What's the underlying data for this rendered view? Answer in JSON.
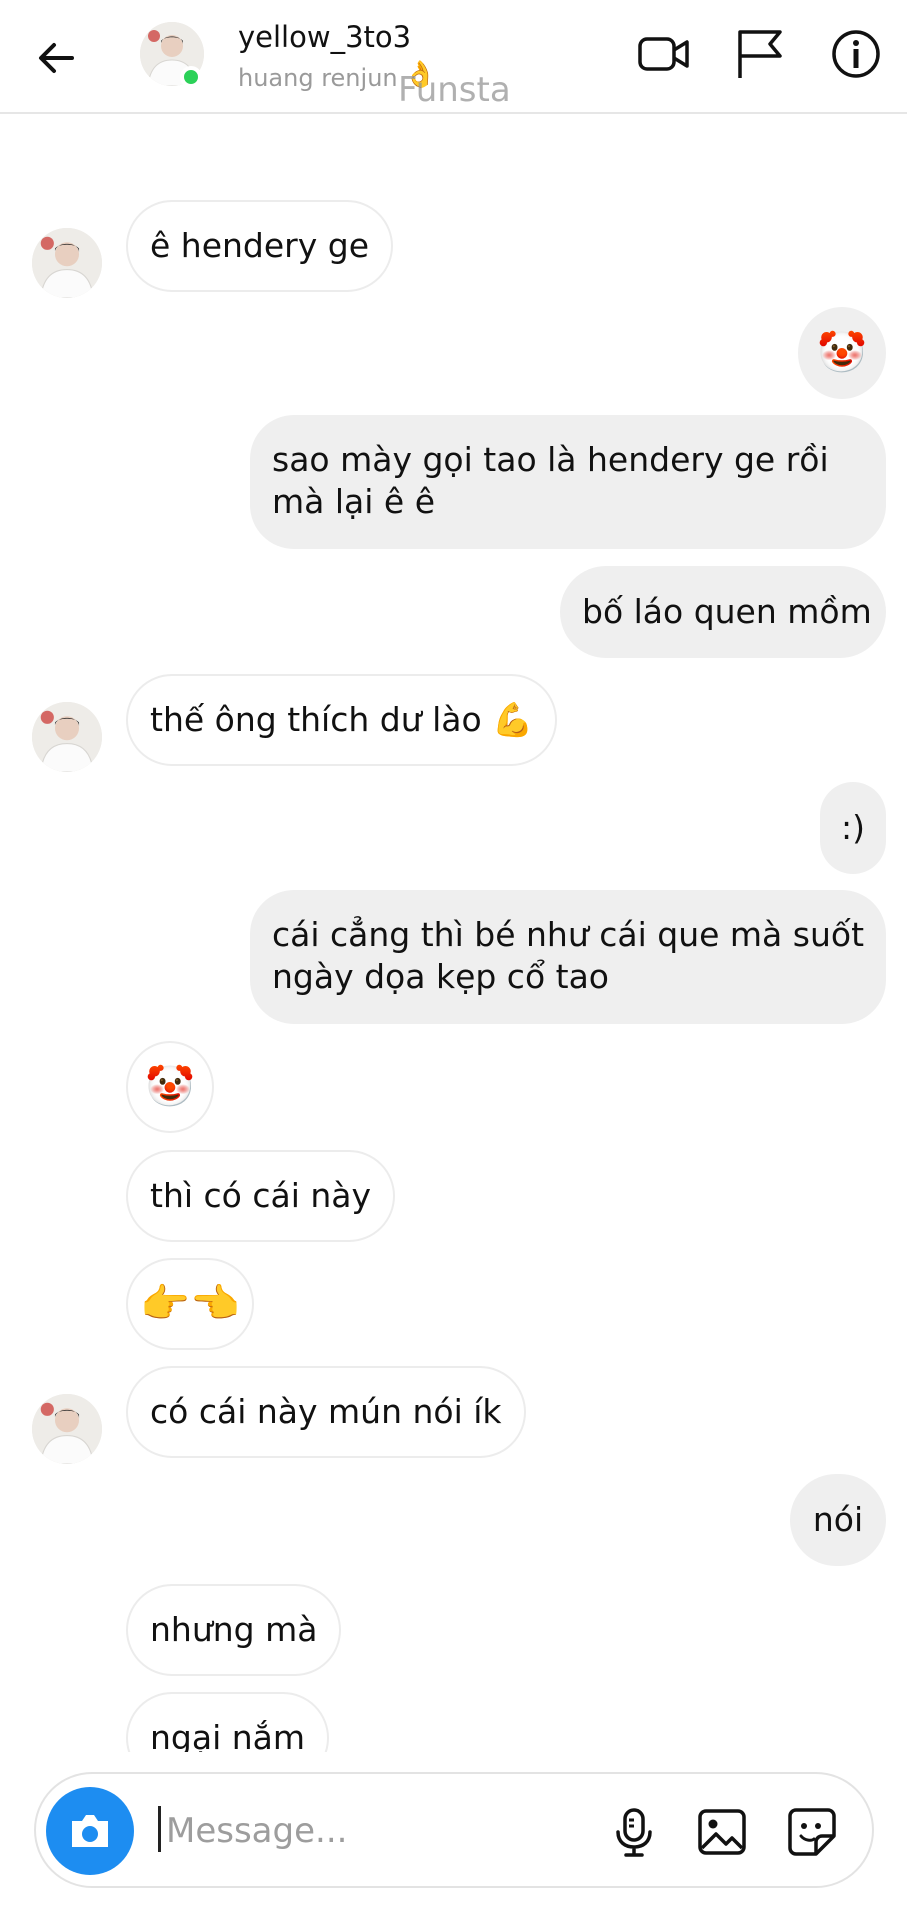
{
  "header": {
    "username": "yellow_3to3",
    "subtitle": "huang renjun",
    "subtitle_emoji": "👌",
    "watermark": "Funsta"
  },
  "messages": [
    {
      "side": "in",
      "text": "ê hendery ge"
    },
    {
      "side": "out",
      "text": "🤡"
    },
    {
      "side": "out",
      "text": "sao mày gọi tao là hendery ge rồi mà lại ê ê"
    },
    {
      "side": "out",
      "text": "bố láo quen mồm"
    },
    {
      "side": "in",
      "text": "thế ông thích dư lào 💪"
    },
    {
      "side": "out",
      "text": ":)"
    },
    {
      "side": "out",
      "text": "cái cẳng thì bé như cái que mà suốt ngày dọa kẹp cổ tao"
    },
    {
      "side": "in",
      "text": "🤡"
    },
    {
      "side": "in",
      "text": "thì có cái này"
    },
    {
      "side": "in",
      "text": "👉👈"
    },
    {
      "side": "in",
      "text": "có cái này mún nói ík"
    },
    {
      "side": "out",
      "text": "nói"
    },
    {
      "side": "in",
      "text": "nhưng mà"
    },
    {
      "side": "in",
      "text": "ngại nắm"
    }
  ],
  "composer": {
    "placeholder": "Message..."
  },
  "colors": {
    "accent": "#1d8df1",
    "online": "#2bd158",
    "outgoing_bubble": "#efefef"
  },
  "icons": [
    "back-arrow-icon",
    "video-call-icon",
    "flag-icon",
    "info-icon",
    "camera-icon",
    "microphone-icon",
    "gallery-icon",
    "sticker-icon"
  ]
}
